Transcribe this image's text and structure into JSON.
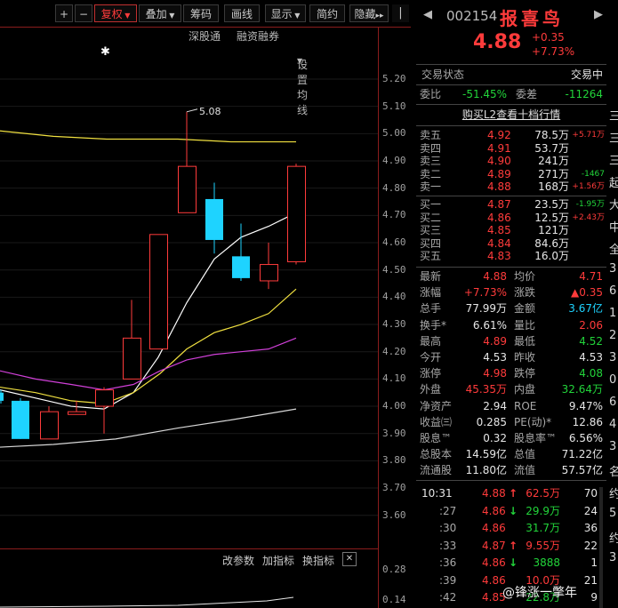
{
  "toolbar": {
    "plus": "+",
    "minus": "−",
    "fuquan": "复权",
    "diejia": "叠加",
    "chouma": "筹码",
    "huaxian": "画线",
    "xianshi": "显示",
    "jianyue": "简约",
    "yincang": "隐藏"
  },
  "chart_links": {
    "shengutong": "深股通",
    "rongzi": "融资融券",
    "shezhi": "设置均线"
  },
  "price_axis": [
    "5.20",
    "5.10",
    "5.00",
    "4.90",
    "4.80",
    "4.70",
    "4.60",
    "4.50",
    "4.40",
    "4.30",
    "4.20",
    "4.10",
    "4.00",
    "3.90",
    "3.80",
    "3.70",
    "3.60"
  ],
  "indicator_axis": [
    "0.28",
    "0.14"
  ],
  "high_marker": "5.08",
  "indicator_bar": {
    "gaicanshu": "改参数",
    "jiazhibiao": "加指标",
    "huanzhibiao": "换指标",
    "close": "✕"
  },
  "stock": {
    "code": "002154",
    "name": "报喜鸟",
    "price": "4.88",
    "change": "+0.35",
    "change_pct": "+7.73%"
  },
  "status": {
    "label": "交易状态",
    "value": "交易中"
  },
  "webi": {
    "wb_label": "委比",
    "wb_value": "-51.45%",
    "wc_label": "委差",
    "wc_value": "-11264"
  },
  "l2_link": "购买L2查看十档行情",
  "sell": [
    {
      "label": "卖五",
      "price": "4.92",
      "vol": "78.5万",
      "delta": "+5.71万"
    },
    {
      "label": "卖四",
      "price": "4.91",
      "vol": "53.7万",
      "delta": ""
    },
    {
      "label": "卖三",
      "price": "4.90",
      "vol": "241万",
      "delta": ""
    },
    {
      "label": "卖二",
      "price": "4.89",
      "vol": "271万",
      "delta": "-1467"
    },
    {
      "label": "卖一",
      "price": "4.88",
      "vol": "168万",
      "delta": "+1.56万"
    }
  ],
  "buy": [
    {
      "label": "买一",
      "price": "4.87",
      "vol": "23.5万",
      "delta": "-1.95万"
    },
    {
      "label": "买二",
      "price": "4.86",
      "vol": "12.5万",
      "delta": "+2.43万"
    },
    {
      "label": "买三",
      "price": "4.85",
      "vol": "121万",
      "delta": ""
    },
    {
      "label": "买四",
      "price": "4.84",
      "vol": "84.6万",
      "delta": ""
    },
    {
      "label": "买五",
      "price": "4.83",
      "vol": "16.0万",
      "delta": ""
    }
  ],
  "stats": [
    {
      "l1": "最新",
      "v1": "4.88",
      "c1": "red",
      "l2": "均价",
      "v2": "4.71",
      "c2": "red"
    },
    {
      "l1": "涨幅",
      "v1": "+7.73%",
      "c1": "red",
      "l2": "涨跌",
      "v2": "▲0.35",
      "c2": "red"
    },
    {
      "l1": "总手",
      "v1": "77.99万",
      "c1": "wht",
      "l2": "金额",
      "v2": "3.67亿",
      "c2": "cyan"
    },
    {
      "l1": "换手*",
      "v1": "6.61%",
      "c1": "wht",
      "l2": "量比",
      "v2": "2.06",
      "c2": "red"
    },
    {
      "l1": "最高",
      "v1": "4.89",
      "c1": "red",
      "l2": "最低",
      "v2": "4.52",
      "c2": "green"
    },
    {
      "l1": "今开",
      "v1": "4.53",
      "c1": "wht",
      "l2": "昨收",
      "v2": "4.53",
      "c2": "wht"
    },
    {
      "l1": "涨停",
      "v1": "4.98",
      "c1": "red",
      "l2": "跌停",
      "v2": "4.08",
      "c2": "green"
    },
    {
      "l1": "外盘",
      "v1": "45.35万",
      "c1": "red",
      "l2": "内盘",
      "v2": "32.64万",
      "c2": "green"
    },
    {
      "l1": "净资产",
      "v1": "2.94",
      "c1": "wht",
      "l2": "ROE",
      "v2": "9.47%",
      "c2": "wht"
    },
    {
      "l1": "收益㈢",
      "v1": "0.285",
      "c1": "wht",
      "l2": "PE(动)*",
      "v2": "12.86",
      "c2": "wht"
    },
    {
      "l1": "股息™",
      "v1": "0.32",
      "c1": "wht",
      "l2": "股息率™",
      "v2": "6.56%",
      "c2": "wht"
    },
    {
      "l1": "总股本",
      "v1": "14.59亿",
      "c1": "wht",
      "l2": "总值",
      "v2": "71.22亿",
      "c2": "wht"
    },
    {
      "l1": "流通股",
      "v1": "11.80亿",
      "c1": "wht",
      "l2": "流值",
      "v2": "57.57亿",
      "c2": "wht"
    }
  ],
  "ticks": [
    {
      "time": "10:31",
      "price": "4.88",
      "arrow": "↑",
      "dir": "up",
      "vol": "62.5万",
      "vcolor": "red",
      "num": "70"
    },
    {
      "time": ":27",
      "price": "4.86",
      "arrow": "↓",
      "dir": "down",
      "vol": "29.9万",
      "vcolor": "green",
      "num": "24"
    },
    {
      "time": ":30",
      "price": "4.86",
      "arrow": "",
      "dir": "",
      "vol": "31.7万",
      "vcolor": "green",
      "num": "36"
    },
    {
      "time": ":33",
      "price": "4.87",
      "arrow": "↑",
      "dir": "up",
      "vol": "9.55万",
      "vcolor": "red",
      "num": "22"
    },
    {
      "time": ":36",
      "price": "4.86",
      "arrow": "↓",
      "dir": "down",
      "vol": "3888",
      "vcolor": "green",
      "num": "1"
    },
    {
      "time": ":39",
      "price": "4.86",
      "arrow": "",
      "dir": "",
      "vol": "10.0万",
      "vcolor": "red",
      "num": "21"
    },
    {
      "time": ":42",
      "price": "4.85",
      "arrow": "",
      "dir": "",
      "vol": "22.8万",
      "vcolor": "green",
      "num": "9"
    }
  ],
  "watermark": "@锋涨一撆年",
  "edge_text": [
    "三",
    "三",
    "三",
    "起",
    "大",
    "中",
    "全",
    "3",
    "6",
    "1",
    "2",
    "3",
    "0",
    "6",
    "4",
    "3",
    "名",
    "约",
    "5",
    "约",
    "3"
  ],
  "colors": {
    "up": "#ff3b3b",
    "down": "#1ed3ff",
    "ma5": "#ffffff",
    "ma10": "#f0e040",
    "ma20": "#d040d8",
    "ma60": "#d8d8d8"
  }
}
